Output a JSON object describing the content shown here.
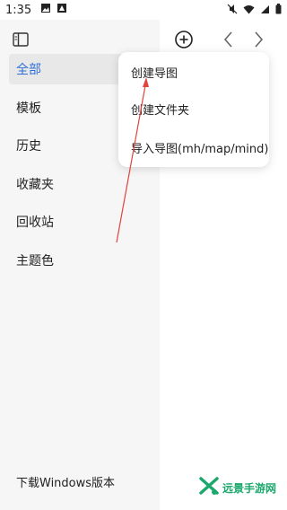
{
  "status_bar": {
    "time": "1:35",
    "icons": [
      "image-icon",
      "notification-a-icon",
      "mute-icon",
      "wifi-icon",
      "signal-icon",
      "battery-icon"
    ]
  },
  "sidebar": {
    "toggle_icon": "sidebar-toggle-icon",
    "items": [
      {
        "label": "全部",
        "active": true
      },
      {
        "label": "模板"
      },
      {
        "label": "历史"
      },
      {
        "label": "收藏夹"
      },
      {
        "label": "回收站"
      },
      {
        "label": "主题色"
      }
    ],
    "footer_label": "下载Windows版本"
  },
  "toolbar": {
    "add_icon": "add-circle-icon",
    "back_icon": "chevron-left-icon",
    "forward_icon": "chevron-right-icon"
  },
  "menu": {
    "items": [
      {
        "label": "创建导图"
      },
      {
        "label": "创建文件夹"
      },
      {
        "label": "导入导图(mh/map/mind)"
      }
    ]
  },
  "watermark": {
    "text": "远景手游网"
  },
  "colors": {
    "accent": "#2e6fd6",
    "sidebar_bg": "#f6f6f7",
    "arrow": "#e0443c",
    "watermark": "#1aa86b"
  }
}
